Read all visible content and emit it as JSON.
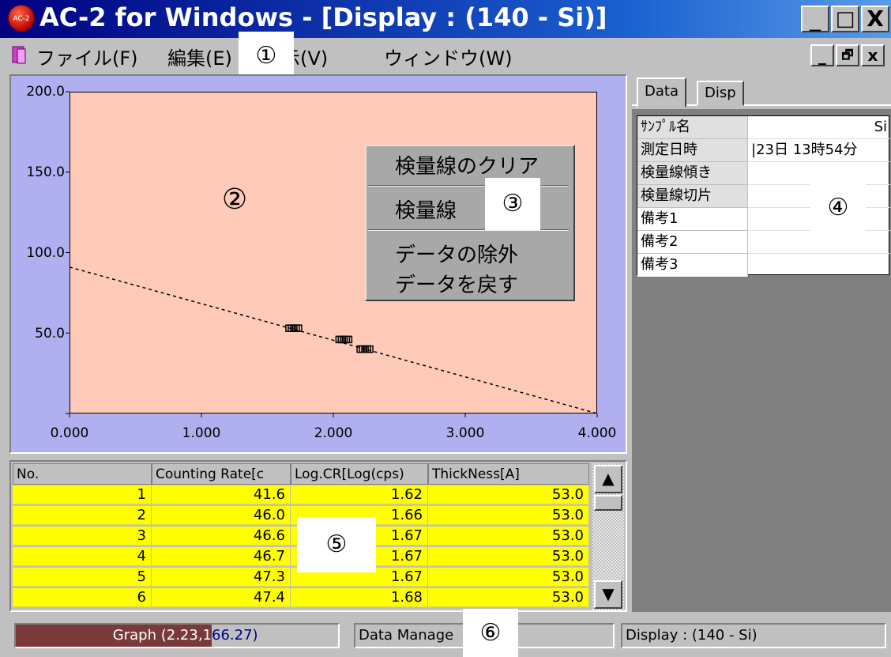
{
  "window": {
    "title": "AC-2 for Windows - [Display : (140 - Si)]",
    "icon_label": "AC-2",
    "controls": {
      "minimize": "_",
      "maximize": "□",
      "close": "X"
    }
  },
  "menubar": {
    "items": [
      "ファイル(F)",
      "編集(E)",
      "表示(V)",
      "ウィンドウ(W)"
    ],
    "mdi_controls": {
      "minimize": "_",
      "restore": "🗗",
      "close": "x"
    }
  },
  "markers": {
    "m1": "①",
    "m2": "②",
    "m3": "③",
    "m4": "④",
    "m5": "⑤",
    "m6": "⑥"
  },
  "chart_data": {
    "type": "scatter",
    "x_ticks": [
      "0.000",
      "1.000",
      "2.000",
      "3.000",
      "4.000"
    ],
    "y_ticks": [
      "200.0",
      "150.0",
      "100.0",
      "50.0"
    ],
    "xlim": [
      0,
      4
    ],
    "ylim": [
      0,
      200
    ],
    "points": [
      {
        "x": 1.7,
        "y": 53
      },
      {
        "x": 2.08,
        "y": 46
      },
      {
        "x": 2.24,
        "y": 40
      }
    ],
    "fit_line": {
      "x0": 0,
      "y0": 91,
      "x1": 4,
      "y1": 0,
      "style": "dashed"
    },
    "colors": {
      "panel": "#b0b0f0",
      "plot": "#ffcbb8"
    }
  },
  "context_menu": {
    "items": [
      "検量線のクリア",
      "検量線",
      "データの除外",
      "データを戻す"
    ]
  },
  "right_panel": {
    "tabs": [
      "Data",
      "Disp"
    ],
    "rows": [
      {
        "label": "ｻﾝﾌﾟﾙ名",
        "value": "Si"
      },
      {
        "label": "測定日時",
        "value": "|23日 13時54分"
      },
      {
        "label": "検量線傾き",
        "value": ""
      },
      {
        "label": "検量線切片",
        "value": ""
      },
      {
        "label": "備考1",
        "value": ""
      },
      {
        "label": "備考2",
        "value": ""
      },
      {
        "label": "備考3",
        "value": ""
      }
    ]
  },
  "table": {
    "headers": [
      "No.",
      "Counting Rate[c",
      "Log.CR[Log(cps)",
      "ThickNess[A]"
    ],
    "rows": [
      [
        "1",
        "41.6",
        "1.62",
        "53.0"
      ],
      [
        "2",
        "46.0",
        "1.66",
        "53.0"
      ],
      [
        "3",
        "46.6",
        "1.67",
        "53.0"
      ],
      [
        "4",
        "46.7",
        "1.67",
        "53.0"
      ],
      [
        "5",
        "47.3",
        "1.67",
        "53.0"
      ],
      [
        "6",
        "47.4",
        "1.68",
        "53.0"
      ]
    ],
    "scroll_up": "▲",
    "scroll_down": "▼"
  },
  "statusbar": {
    "graph_prefix": "Graph (2.23,1",
    "graph_suffix": "66.27)",
    "data_manager": "Data Manage",
    "display": "Display : (140 - Si)"
  }
}
